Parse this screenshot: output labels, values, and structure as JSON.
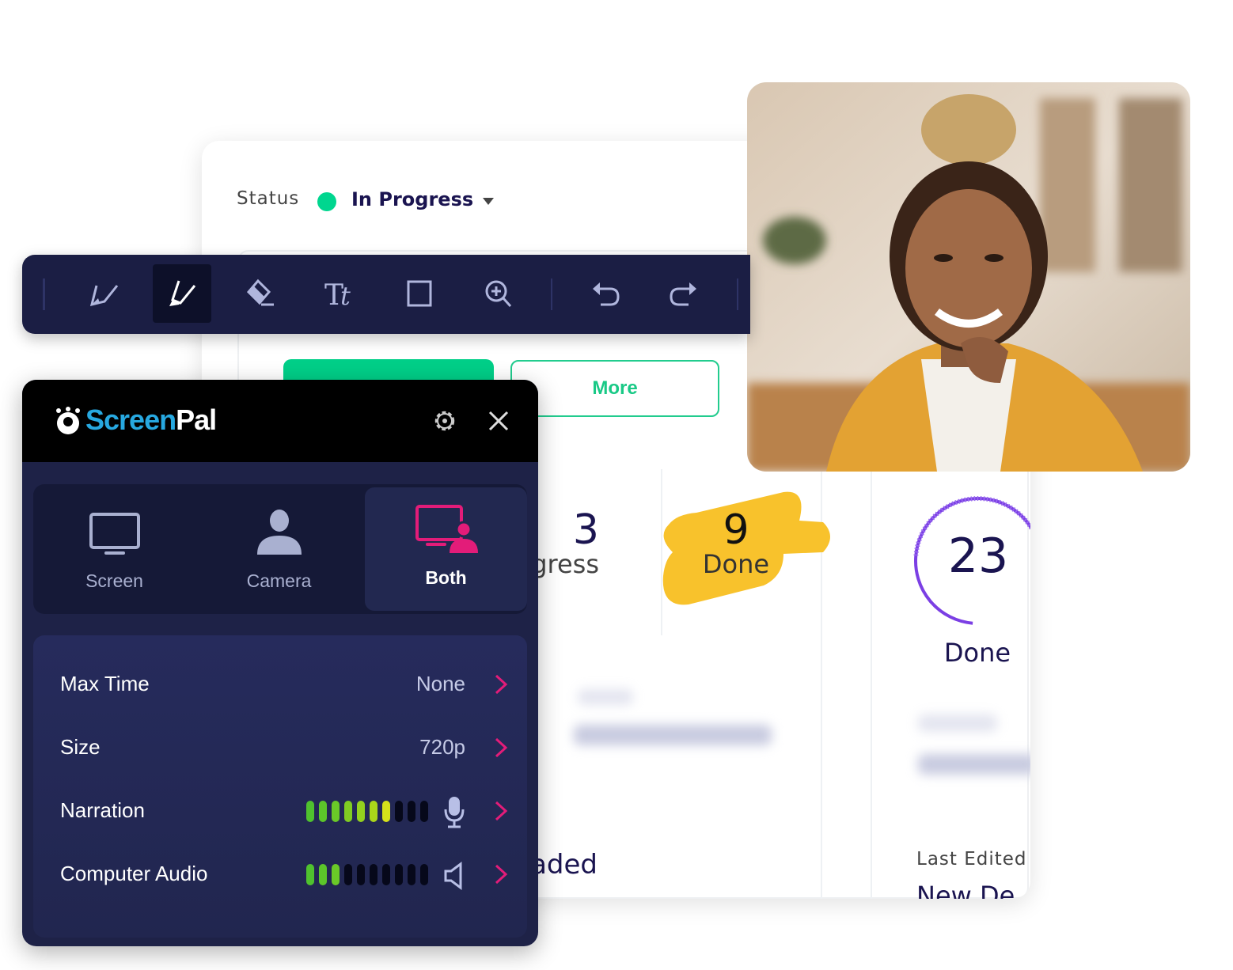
{
  "status": {
    "label": "Status",
    "value": "In Progress",
    "dot_color": "#00d68f"
  },
  "buttons": {
    "more": "More"
  },
  "stats": [
    {
      "number": "3",
      "label": "In Progress"
    },
    {
      "number": "9",
      "label": "Done",
      "highlight_color": "#f8c22c"
    },
    {
      "number": "23",
      "label": "Done",
      "ring_color": "#7b3fe4"
    }
  ],
  "lower": {
    "uploaded": "Uploaded",
    "last_edited": "Last Edited",
    "last_edited_value": "New De"
  },
  "toolbar": {
    "tools": [
      "pen-icon",
      "highlighter-icon",
      "eraser-icon",
      "text-icon",
      "rectangle-icon",
      "zoom-icon",
      "undo-icon",
      "redo-icon"
    ],
    "active_tool": "highlighter-icon"
  },
  "recorder": {
    "brand": {
      "screen": "Screen",
      "pal": "Pal"
    },
    "modes": [
      {
        "label": "Screen",
        "icon": "monitor-icon"
      },
      {
        "label": "Camera",
        "icon": "person-icon"
      },
      {
        "label": "Both",
        "icon": "monitor-person-icon",
        "active": true
      }
    ],
    "settings": [
      {
        "label": "Max Time",
        "value": "None"
      },
      {
        "label": "Size",
        "value": "720p"
      },
      {
        "label": "Narration",
        "level": 7,
        "segments": 10,
        "icon": "microphone-icon"
      },
      {
        "label": "Computer Audio",
        "level": 3,
        "segments": 10,
        "icon": "speaker-icon"
      }
    ],
    "accent": "#e31c79",
    "brand_color": "#27a8e0"
  }
}
